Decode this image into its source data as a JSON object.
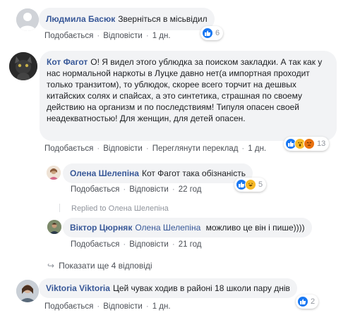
{
  "colors": {
    "link": "#385898",
    "like": "#1877f2",
    "haha": "#f7b928",
    "angry": "#e9710f",
    "bubble": "#f2f3f5"
  },
  "comments": [
    {
      "author": "Людмила Басюк",
      "text": "Зверніться в місьвідил",
      "actions": {
        "like": "Подобається",
        "reply": "Відповісти",
        "time": "1 дн."
      },
      "reactions": {
        "icons": [
          "like-icon"
        ],
        "count": "6"
      }
    },
    {
      "author": "Кот Фагот",
      "text": "О! Я видел этого ублюдка за поиском закладки. А так как у нас нормальной наркоты в Луцке давно нет(а импортная проходит только транзитом), то ублюдок, скорее всего торчит на дешвых китайских солях и спайсах, а это синтетика, страшная по своему действию на организм и по последствиям! Типуля опасен своей неадекватностью! Для женщин, для детей опасен.",
      "actions": {
        "like": "Подобається",
        "reply": "Відповісти",
        "translate": "Переглянути переклад",
        "time": "1 дн."
      },
      "reactions": {
        "icons": [
          "like-icon",
          "wow-icon",
          "angry-icon"
        ],
        "count": "13"
      },
      "replies": [
        {
          "author": "Олена Шелепіна",
          "text": "Кот Фагот така обізнаність",
          "actions": {
            "like": "Подобається",
            "reply": "Відповісти",
            "time": "22 год"
          },
          "reactions": {
            "icons": [
              "like-icon",
              "haha-icon"
            ],
            "count": "5"
          }
        },
        {
          "replied_to_prefix": "Replied to",
          "replied_to_name": "Олена Шелепіна",
          "author": "Віктор Цюрняк",
          "mention": "Олена Шелепіна",
          "text": "можливо це він і пише))))",
          "actions": {
            "like": "Подобається",
            "reply": "Відповісти",
            "time": "21 год"
          }
        }
      ],
      "more_replies": "Показати ще 4 відповіді"
    },
    {
      "author": "Viktoria Viktoria",
      "text": "Цей чувак ходив в районі 18 школи пару днів",
      "actions": {
        "like": "Подобається",
        "reply": "Відповісти",
        "time": "1 дн."
      },
      "reactions": {
        "icons": [
          "like-icon"
        ],
        "count": "2"
      }
    }
  ]
}
